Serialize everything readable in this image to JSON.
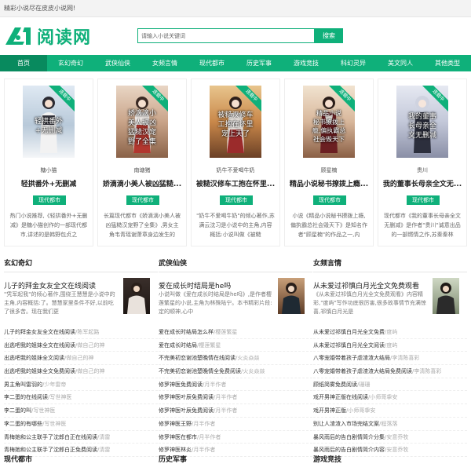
{
  "topbar": {
    "text": "精彩小说尽在皮皮小说网!"
  },
  "header": {
    "logo_text": "阅读网",
    "search_placeholder": "请输入小说关键词",
    "search_button": "搜索"
  },
  "colors": {
    "accent": "#0fb07a",
    "accent_dark": "#088a5e"
  },
  "nav": [
    {
      "label": "首页",
      "active": true
    },
    {
      "label": "玄幻奇幻"
    },
    {
      "label": "武侠仙侠"
    },
    {
      "label": "女频言情"
    },
    {
      "label": "现代都市"
    },
    {
      "label": "历史军事"
    },
    {
      "label": "游戏竞技"
    },
    {
      "label": "科幻灵异"
    },
    {
      "label": "美文同人"
    },
    {
      "label": "其他类型"
    }
  ],
  "recommended": [
    {
      "ribbon": "连载中",
      "cover_text": "轻拱番外\n+无删减",
      "author": "糖小猫",
      "title": "轻拱番外+无删减",
      "tag": "现代都市",
      "desc": "热门小说推荐,《轻拱番外+无删减》是糖小猫创作的一部现代都市,讲述的是韩野包贞之"
    },
    {
      "ribbon": "连载中",
      "cover_text": "娇滴滴小\n美人被凶\n猛糙汉宠\n野了全集",
      "author": "南塘猪",
      "title": "娇滴滴小美人被凶猛糙...",
      "tag": "现代都市",
      "desc": "长篇现代都市《娇滴滴小美人被凶猛糙汉宠野了全集》,男女主角韦青瑶谢萧章身边发生的"
    },
    {
      "ribbon": "连载中",
      "cover_text": "被糙汉修车\n工抱在怀里\n宠上天了",
      "author": "奶牛不爱喝牛奶",
      "title": "被糙汉修车工抱在怀里...",
      "tag": "现代都市",
      "desc": "\"奶牛不爱喝牛奶\"的倾心著作,苏满云沈习是小说中的主角,内容概括:小说叫做《被糙"
    },
    {
      "ribbon": "连载中",
      "cover_text": "精品小说\n秘书撩拨上\n瘾,偏执霸总\n社会毁天下",
      "author": "顾星楠",
      "title": "精品小说秘书撩拨上瘾...",
      "tag": "现代都市",
      "desc": "小说《精品小说秘书撩拨上瘾,偏执霸总社会毁天下》是知名作者\"顾星楠\"的作品之一,内"
    },
    {
      "ribbon": "连载中",
      "cover_text": "我的董事\n长母亲全\n文无删减",
      "author": "贵川",
      "title": "我的董事长母亲全文无...",
      "tag": "现代都市",
      "desc": "现代都市《我的董事长母亲全文无删减》是作者\"贵川\"诚意出品的一部燃情之作,苏秦秦林"
    }
  ],
  "columns": [
    {
      "heading": "玄幻奇幻",
      "feature": {
        "title": "儿子的拜金女友全文在线阅读",
        "desc": "\"凭军起我\"的倾心著作,围绕王慧慧是小说中的主角,内容概括:了。慧慧家里条件不好,以前吃了很多苦。现在我们更"
      },
      "items": [
        {
          "title": "儿子的拜金女友全文在线阅读",
          "author": "/陈军起路"
        },
        {
          "title": "出逃吧我的姐妹全文在线阅读",
          "author": "/做自己的神"
        },
        {
          "title": "出逃吧我的姐妹全文阅读",
          "author": "/做自己的神"
        },
        {
          "title": "出逃吧我的姐妹全文免费阅读",
          "author": "/做自己的神"
        },
        {
          "title": "男主角叫雷羽的",
          "author": "/少年雷帝"
        },
        {
          "title": "李二蛋的在线阅读",
          "author": "/写世神医"
        },
        {
          "title": "李二蛋的叫",
          "author": "/写世神医"
        },
        {
          "title": "李二蛋的有哪些",
          "author": "/写世神医"
        },
        {
          "title": "青梅她和公主联手了沈郎白正在线阅读",
          "author": "/清雷"
        },
        {
          "title": "青梅她和公主联手了沈郎白正免费阅读",
          "author": "/清雷"
        }
      ],
      "footer": "现代都市"
    },
    {
      "heading": "武侠仙侠",
      "feature": {
        "title": "爱在成长时结局是he吗",
        "desc": "小说叫做《爱在成长时结局是he吗》,是作者樱莲繁星的小说,主角为林殊陆宁。本书精彩片段:定的顺神,心中"
      },
      "items": [
        {
          "title": "爱在成长时结局怎么样",
          "author": "/樱莲繁星"
        },
        {
          "title": "爱在成长时结局",
          "author": "/樱莲繁星"
        },
        {
          "title": "不完美初恋谢池楚晚情在线阅读",
          "author": "/火炎焱燚"
        },
        {
          "title": "不完美初恋谢池楚晚情全免费阅读",
          "author": "/火炎焱燚"
        },
        {
          "title": "修罗神医免费阅读",
          "author": "/月半作者"
        },
        {
          "title": "修罗神医叶辰免费阅读",
          "author": "/月半作者"
        },
        {
          "title": "修罗神医叶辰免费阅读",
          "author": "/月半作者"
        },
        {
          "title": "修罗神医王野",
          "author": "/月半作者"
        },
        {
          "title": "修罗神医在都市",
          "author": "/月半作者"
        },
        {
          "title": "修罗神医林炎",
          "author": "/月半作者"
        }
      ],
      "footer": "历史军事"
    },
    {
      "heading": "女频言情",
      "feature": {
        "title": "从未爱过祁慎白月光全文免费观看",
        "desc": "《从未爱过祁慎白月光全文免费观看》内容精彩,\"度屿\"写作功底很厉害,很多故事情节充满惊喜,祁慎白月光是"
      },
      "items": [
        {
          "title": "从未爱过祁慎白月光全文免费",
          "author": "/度屿"
        },
        {
          "title": "从未爱过祁慎白月光全文阅读",
          "author": "/度屿"
        },
        {
          "title": "八零宠婚带着孩子虐渣渣大结局",
          "author": "/李清陈喜彩"
        },
        {
          "title": "八零宠婚带着孩子虐渣渣大结局免费阅读",
          "author": "/李清陈喜彩"
        },
        {
          "title": "顾纸简雾免费阅读",
          "author": "/珊珊"
        },
        {
          "title": "戏开男神正版在线阅读",
          "author": "/小师哥挚安"
        },
        {
          "title": "戏开男神正版",
          "author": "/小师哥挚安"
        },
        {
          "title": "别让人渣渣入市场完结文案",
          "author": "/程落落"
        },
        {
          "title": "暴风雨后的告白剧情简介分集",
          "author": "/安意乔牧"
        },
        {
          "title": "暴风雨后的告白剧情简介内容",
          "author": "/安意乔牧"
        }
      ],
      "footer": "游戏竞技"
    }
  ]
}
